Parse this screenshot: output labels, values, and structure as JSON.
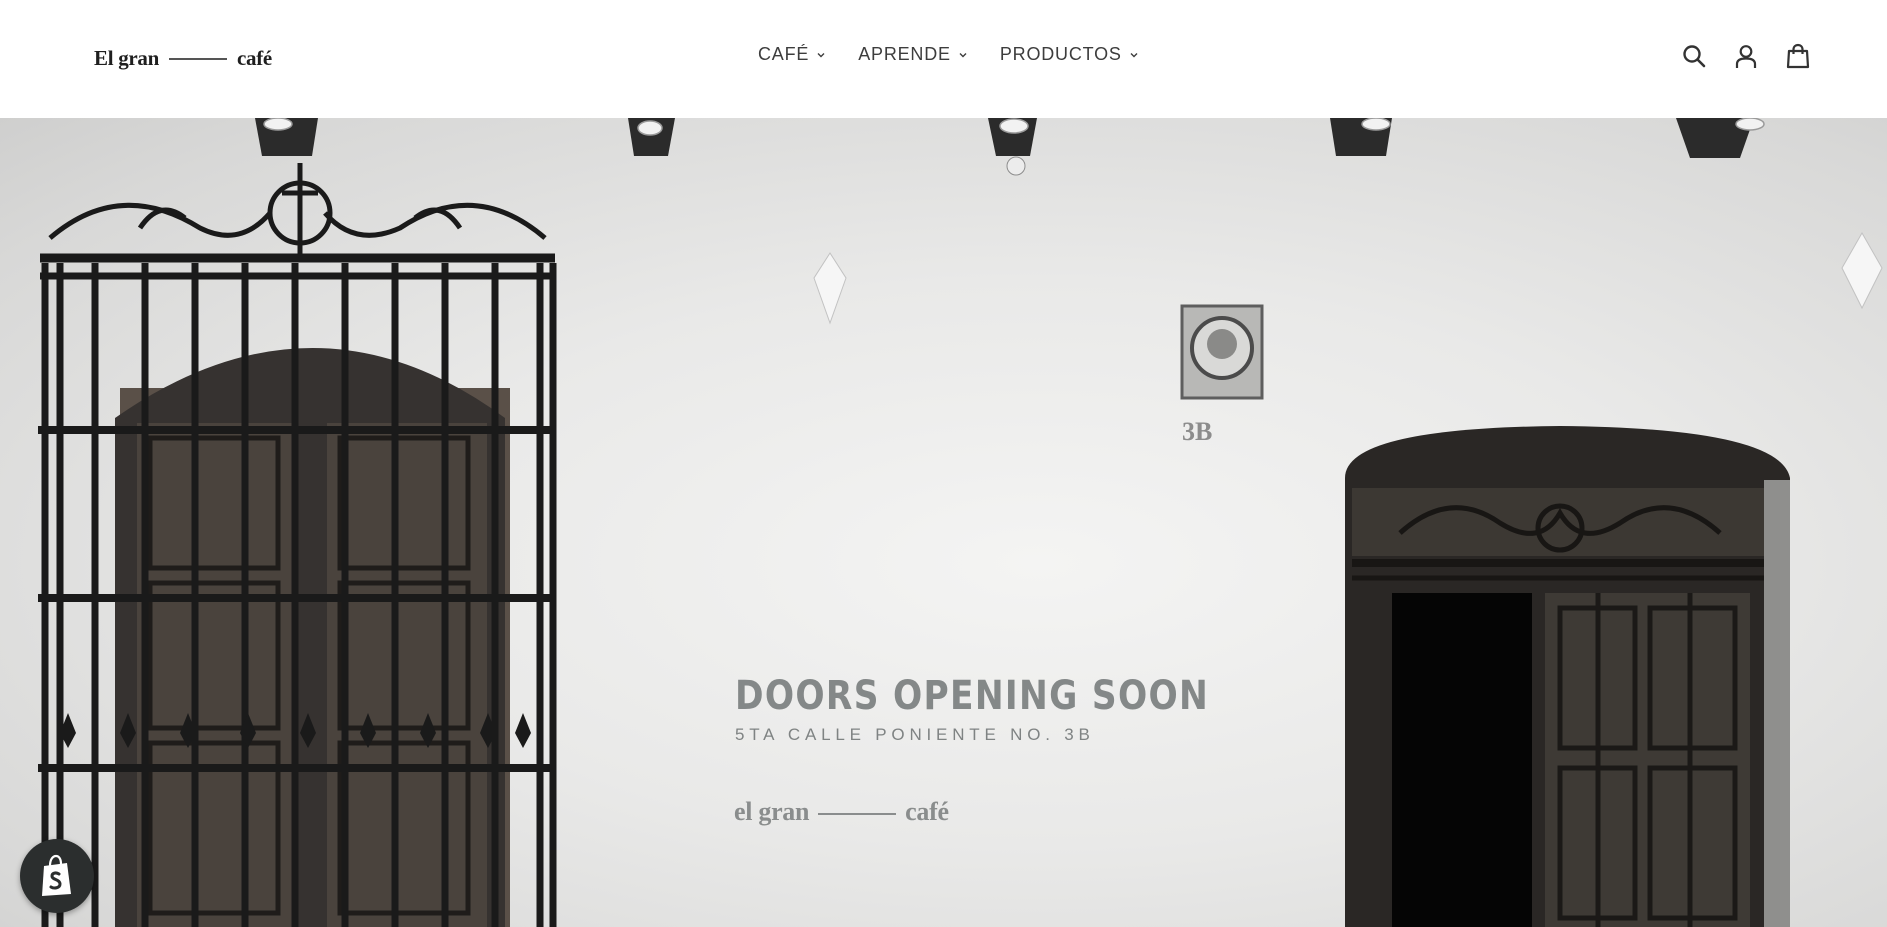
{
  "header": {
    "logo": {
      "left": "El gran",
      "right": "café"
    },
    "nav": [
      {
        "label": "CAFÉ",
        "icon": "chevron-down-icon"
      },
      {
        "label": "APRENDE",
        "icon": "chevron-down-icon"
      },
      {
        "label": "PRODUCTOS",
        "icon": "chevron-down-icon"
      }
    ],
    "icons": [
      "search-icon",
      "account-icon",
      "cart-icon"
    ]
  },
  "hero": {
    "title": "DOORS OPENING SOON",
    "subtitle": "5TA CALLE PONIENTE NO. 3B",
    "logo": {
      "left": "el gran",
      "right": "café"
    },
    "house_number": "3B"
  },
  "badge": {
    "icon": "shopify-bag-icon"
  }
}
